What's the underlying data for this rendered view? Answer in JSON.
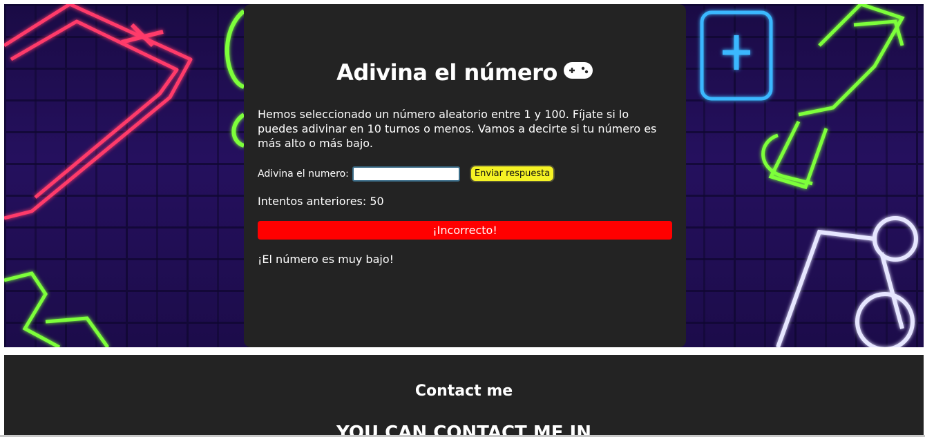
{
  "game": {
    "title": "Adivina el número",
    "title_icon": "gamepad-icon",
    "intro": "Hemos seleccionado un número aleatorio entre 1 y 100. Fíjate si lo puedes adivinar en 10 turnos o menos. Vamos a decirte si tu número es más alto o más bajo.",
    "guess_label": "Adivina el numero:",
    "guess_value": "",
    "submit_label": "Enviar respuesta",
    "attempts_text": "Intentos anteriores: 50",
    "result_text": "¡Incorrecto!",
    "hint_text": "¡El número es muy bajo!"
  },
  "footer": {
    "title": "Contact me",
    "subtitle": "YOU CAN CONTACT ME IN"
  },
  "colors": {
    "card_bg": "#232323",
    "result_bg": "#ff0000",
    "button_bg": "#f5f224",
    "neon_pink": "#ff3b6b",
    "neon_green": "#7dff3a",
    "neon_blue": "#3ab8ff",
    "neon_white": "#e6e6ff"
  }
}
